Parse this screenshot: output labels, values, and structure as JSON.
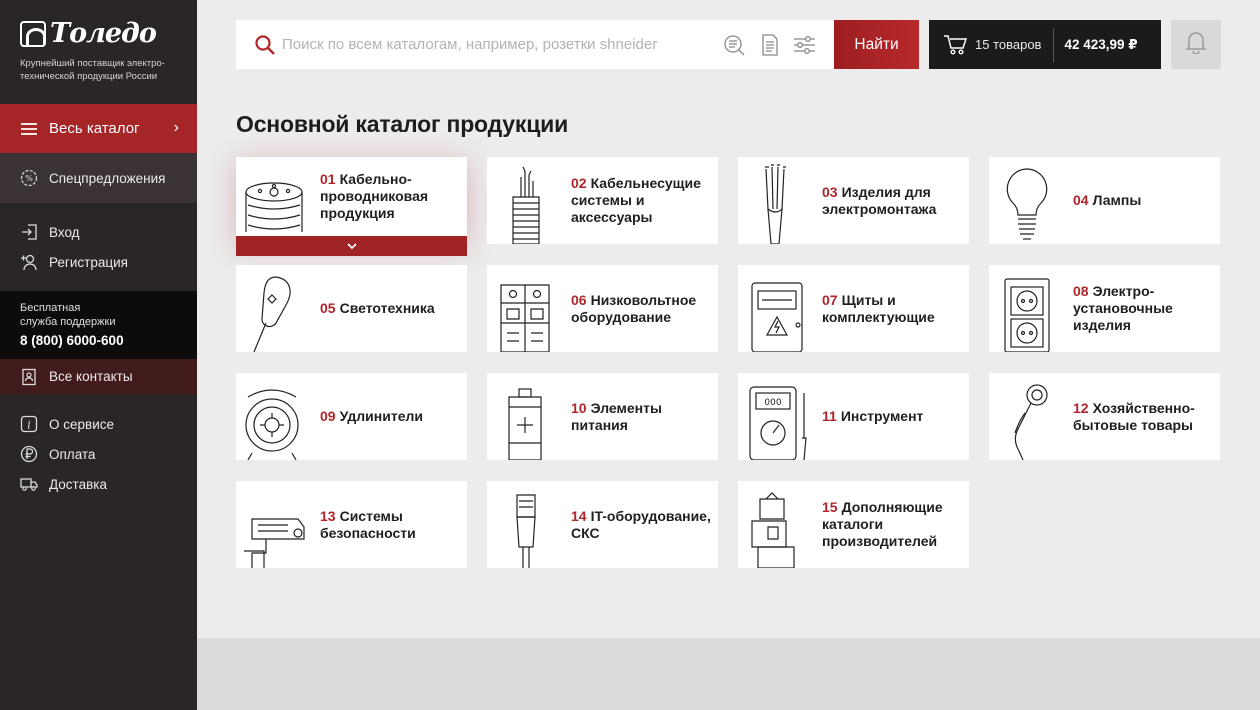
{
  "brand": {
    "name": "Толедо",
    "tagline": "Крупнейший поставщик электро-технической продукции России"
  },
  "sidebar": {
    "catalog_label": "Весь каталог",
    "special_label": "Спецпредложения",
    "login_label": "Вход",
    "register_label": "Регистрация",
    "support_text_1": "Бесплатная",
    "support_text_2": "служба поддержки",
    "support_phone": "8 (800) 6000-600",
    "contacts_label": "Все контакты",
    "about_label": "О сервисе",
    "payment_label": "Оплата",
    "delivery_label": "Доставка"
  },
  "search": {
    "placeholder": "Поиск по всем каталогам, например, розетки shneider",
    "button": "Найти"
  },
  "cart": {
    "count_label": "15 товаров",
    "total": "42 423,99 ₽"
  },
  "page_title": "Основной каталог продукции",
  "categories": [
    {
      "num": "01",
      "name": "Кабельно-проводниковая продукция",
      "icon": "cable-reel-icon"
    },
    {
      "num": "02",
      "name": "Кабельнесущие системы и аксессуары",
      "icon": "cable-conduit-icon"
    },
    {
      "num": "03",
      "name": "Изделия для электромонтажа",
      "icon": "wires-icon"
    },
    {
      "num": "04",
      "name": "Лампы",
      "icon": "bulb-icon"
    },
    {
      "num": "05",
      "name": "Светотехника",
      "icon": "lamp-icon"
    },
    {
      "num": "06",
      "name": "Низковольтное оборудование",
      "icon": "breaker-icon"
    },
    {
      "num": "07",
      "name": "Щиты и комплектующие",
      "icon": "panel-icon"
    },
    {
      "num": "08",
      "name": "Электро-установочные изделия",
      "icon": "socket-icon"
    },
    {
      "num": "09",
      "name": "Удлинители",
      "icon": "extension-reel-icon"
    },
    {
      "num": "10",
      "name": "Элементы питания",
      "icon": "battery-icon"
    },
    {
      "num": "11",
      "name": "Инструмент",
      "icon": "multimeter-icon"
    },
    {
      "num": "12",
      "name": "Хозяйственно-бытовые товары",
      "icon": "household-icon"
    },
    {
      "num": "13",
      "name": "Системы безопасности",
      "icon": "camera-icon"
    },
    {
      "num": "14",
      "name": "IT-оборудование, СКС",
      "icon": "connector-icon"
    },
    {
      "num": "15",
      "name": "Дополняющие каталоги производителей",
      "icon": "boxes-icon"
    }
  ],
  "colors": {
    "accent": "#a62526",
    "sidebar": "#2a2527",
    "background": "#ececec"
  }
}
